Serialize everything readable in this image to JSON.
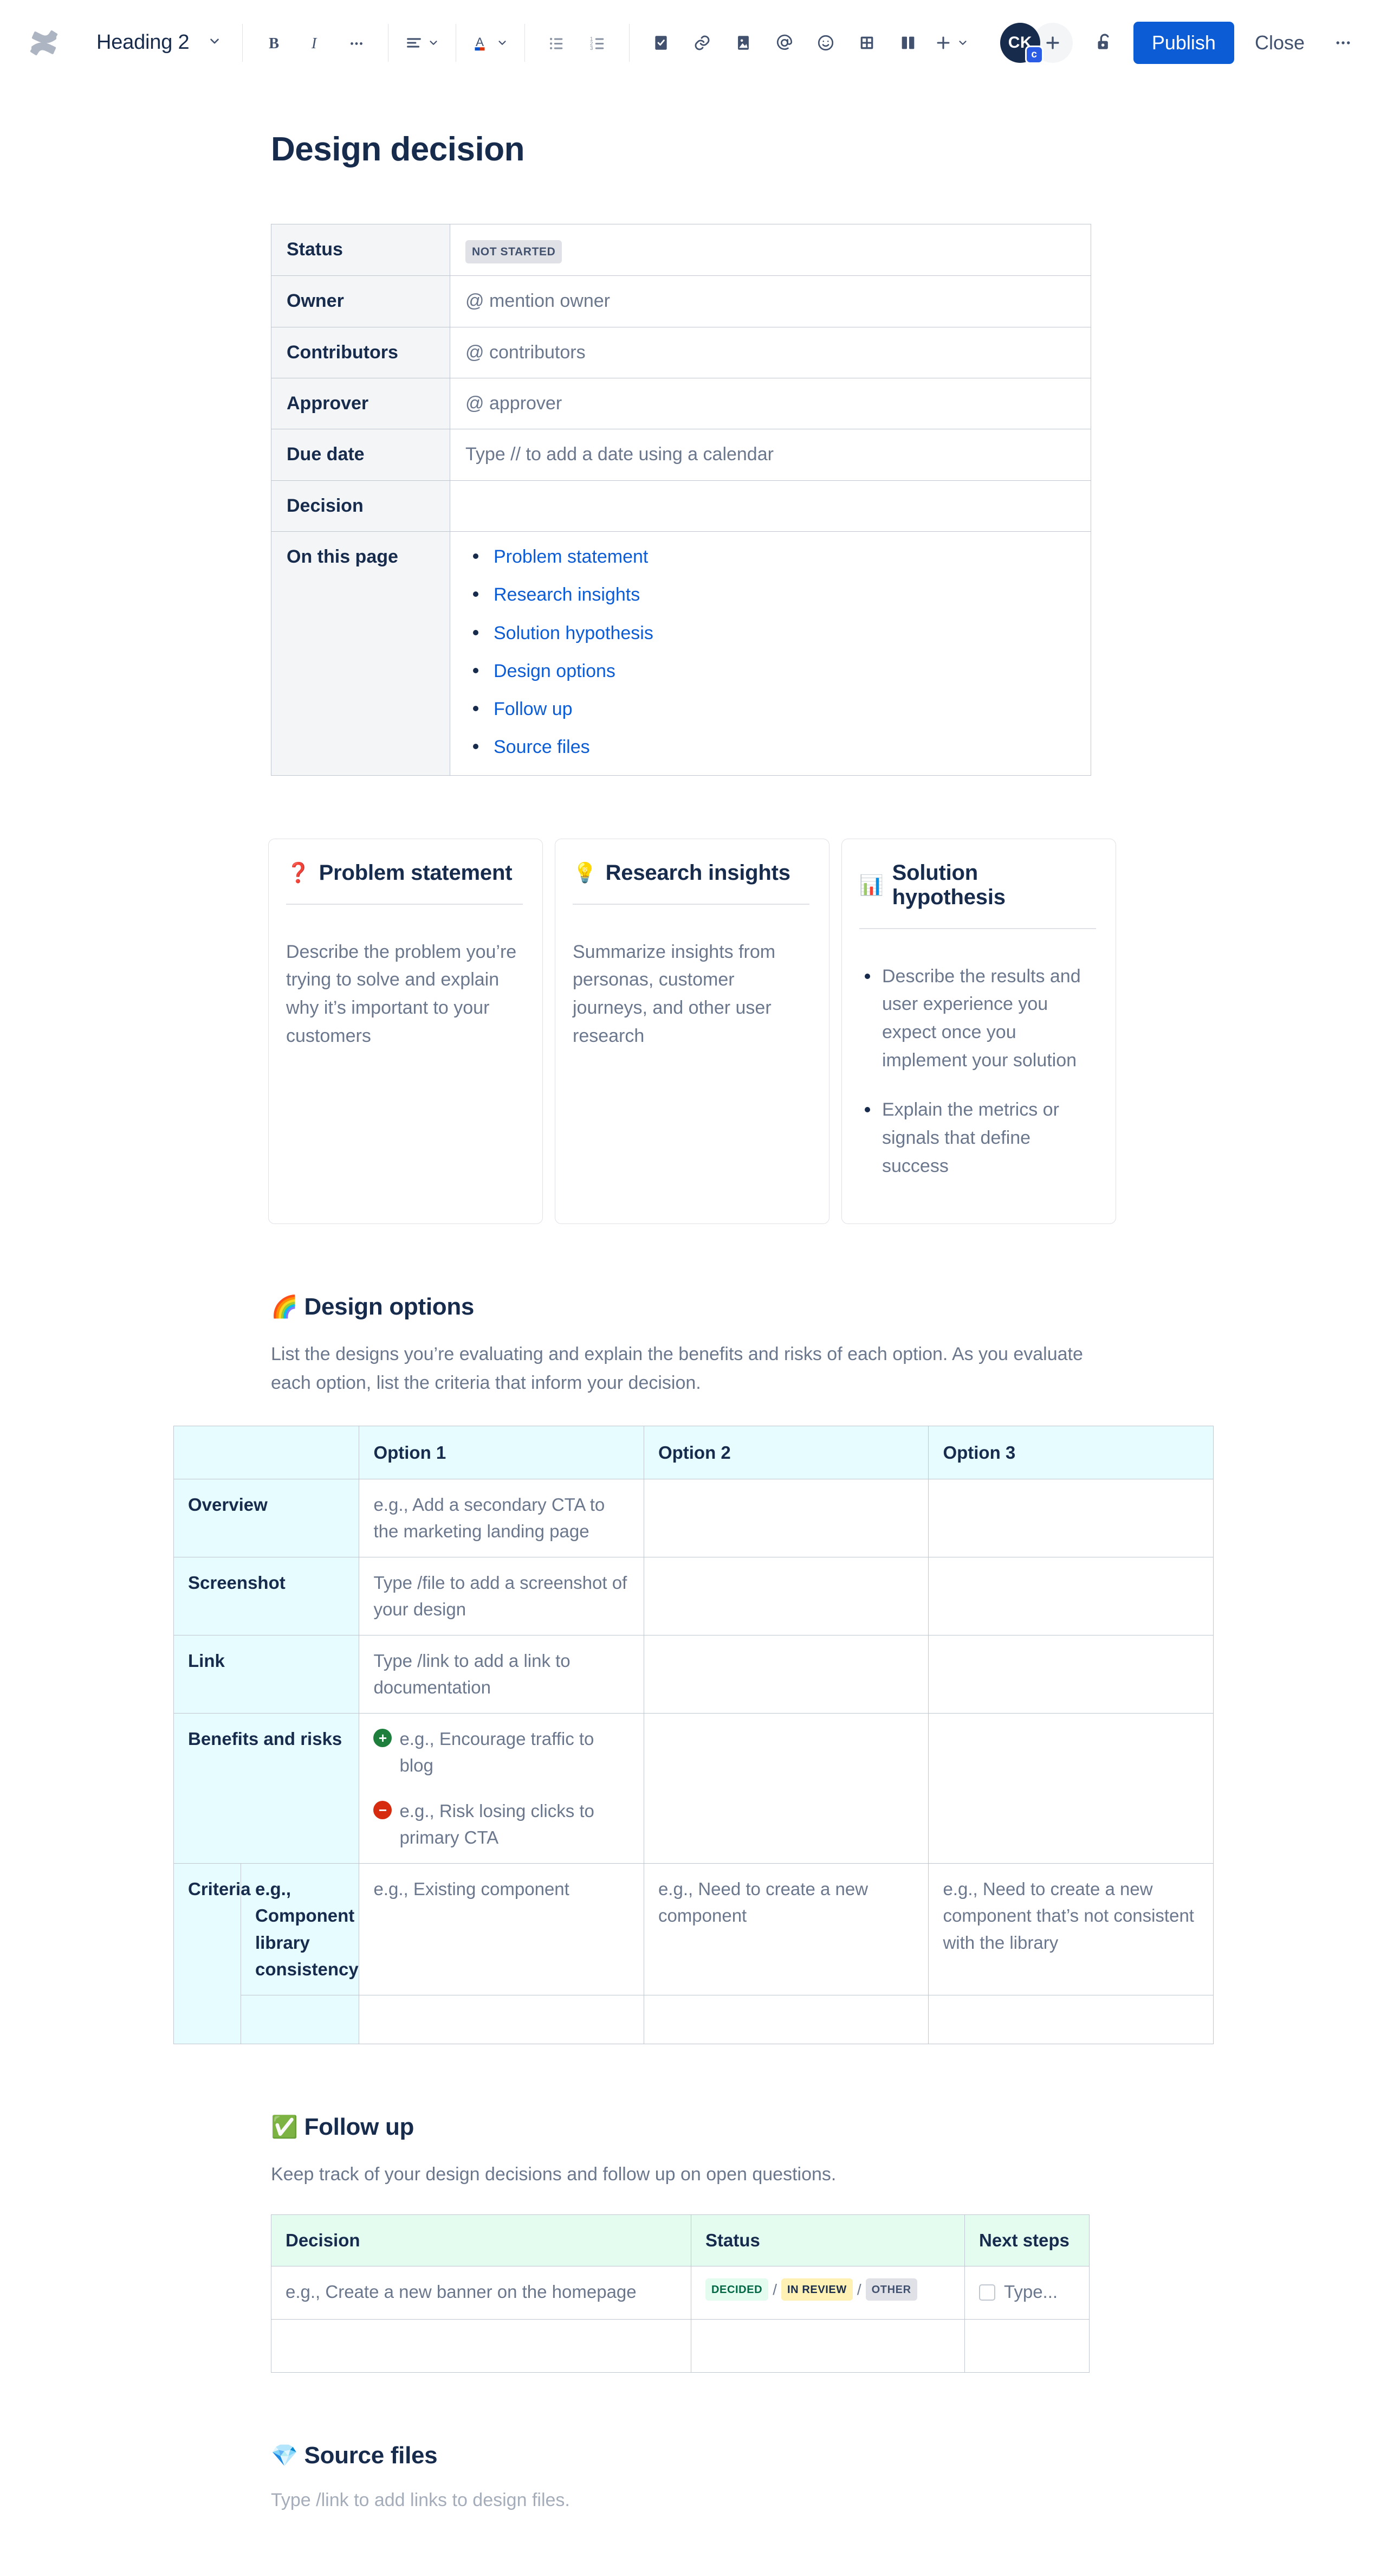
{
  "toolbar": {
    "logo_icon": "confluence-logo-icon",
    "style_value": "Heading 2",
    "style_chevron_icon": "chevron-down-icon",
    "bold_label": "B",
    "italic_label": "I",
    "more_formatting_icon": "ellipsis-icon",
    "align_icon": "text-align-icon",
    "text_color_label": "A",
    "bullet_list_icon": "bullet-list-icon",
    "numbered_list_icon": "numbered-list-icon",
    "task_icon": "task-checkbox-icon",
    "link_icon": "link-icon",
    "image_icon": "image-icon",
    "mention_icon": "mention-at-icon",
    "emoji_icon": "emoji-smiley-icon",
    "table_icon": "table-icon",
    "layout_icon": "page-layout-icon",
    "insert_icon": "plus-icon",
    "avatar_initials": "CK",
    "avatar_badge": "c",
    "add_people_icon": "plus-icon",
    "restrictions_icon": "unlock-icon",
    "publish_label": "Publish",
    "close_label": "Close",
    "more_actions_icon": "ellipsis-icon"
  },
  "page": {
    "title": "Design decision"
  },
  "info_table": {
    "rows": [
      {
        "key": "Status",
        "type": "lozenge",
        "value": "NOT STARTED"
      },
      {
        "key": "Owner",
        "type": "text",
        "value": "@ mention owner"
      },
      {
        "key": "Contributors",
        "type": "text",
        "value": "@ contributors"
      },
      {
        "key": "Approver",
        "type": "text",
        "value": "@ approver"
      },
      {
        "key": "Due date",
        "type": "text",
        "value": "Type // to add a date using a calendar"
      },
      {
        "key": "Decision",
        "type": "text",
        "value": ""
      }
    ],
    "on_this_page_label": "On this page",
    "on_this_page_links": [
      "Problem statement",
      "Research insights",
      "Solution hypothesis",
      "Design options",
      "Follow up",
      "Source files"
    ]
  },
  "cards": [
    {
      "emoji": "❓",
      "icon_name": "red-question-mark-emoji",
      "title": "Problem statement",
      "body": "Describe the problem you’re trying to solve and explain why it’s important to your customers",
      "bullets": []
    },
    {
      "emoji": "💡",
      "icon_name": "light-bulb-emoji",
      "title": "Research insights",
      "body": "Summarize insights from personas, customer journeys, and other user research",
      "bullets": []
    },
    {
      "emoji": "📊",
      "icon_name": "bar-chart-emoji",
      "title": "Solution hypothesis",
      "body": "",
      "bullets": [
        "Describe the results and user experience you expect once you implement your solution",
        "Explain the metrics or signals that define success"
      ]
    }
  ],
  "design_options": {
    "emoji": "🌈",
    "icon_name": "rainbow-emoji",
    "title": "Design options",
    "description": "List the designs you’re evaluating and explain the benefits and risks of each option. As you evaluate each option, list the criteria that inform your decision.",
    "headers": [
      "",
      "Option 1",
      "Option 2",
      "Option 3"
    ],
    "rows": [
      {
        "label": "Overview",
        "cells": [
          "e.g., Add a secondary CTA to the marketing landing page",
          "",
          ""
        ]
      },
      {
        "label": "Screenshot",
        "cells": [
          "Type /file to add a screenshot of your design",
          "",
          ""
        ]
      },
      {
        "label": "Link",
        "cells": [
          "Type /link to add a link to documentation",
          "",
          ""
        ]
      },
      {
        "label": "Benefits and risks",
        "benefits": [
          {
            "sign": "+",
            "icon_name": "plus-circle-green-icon",
            "text": "e.g., Encourage traffic to blog"
          },
          {
            "sign": "−",
            "icon_name": "minus-circle-red-icon",
            "text": "e.g., Risk losing clicks to primary CTA"
          }
        ],
        "cells": [
          "",
          "",
          ""
        ]
      }
    ],
    "criteria_label": "Criteria",
    "criteria_rows": [
      {
        "sub": "e.g., Component library consistency",
        "cells": [
          "e.g., Existing component",
          "e.g., Need to create a new component",
          "e.g., Need to create a new component that’s not consistent with the library"
        ]
      },
      {
        "sub": "",
        "cells": [
          "",
          "",
          ""
        ]
      }
    ]
  },
  "follow_up": {
    "emoji": "✅",
    "icon_name": "green-check-emoji",
    "title": "Follow up",
    "description": "Keep track of your design decisions and follow up on open questions.",
    "headers": [
      "Decision",
      "Status",
      "Next steps"
    ],
    "rows": [
      {
        "decision": "e.g., Create a new banner on the homepage",
        "status_options": [
          "DECIDED",
          "IN REVIEW",
          "OTHER"
        ],
        "status_separator": "/",
        "next_steps": "Type..."
      },
      {
        "decision": "",
        "status_options": [],
        "status_separator": "",
        "next_steps": ""
      }
    ]
  },
  "source_files": {
    "emoji": "💎",
    "icon_name": "gem-stone-emoji",
    "title": "Source files",
    "placeholder": "Type /link to add links to design files."
  },
  "colors": {
    "accent_blue": "#0B5CD5",
    "link_blue": "#0B5CD5",
    "text": "#172B4D",
    "subtle_text": "#6B778C",
    "border": "#C1C7D0",
    "header_cyan": "#E6FCFF",
    "header_green": "#E3FCEF",
    "key_grey": "#F4F5F7"
  }
}
